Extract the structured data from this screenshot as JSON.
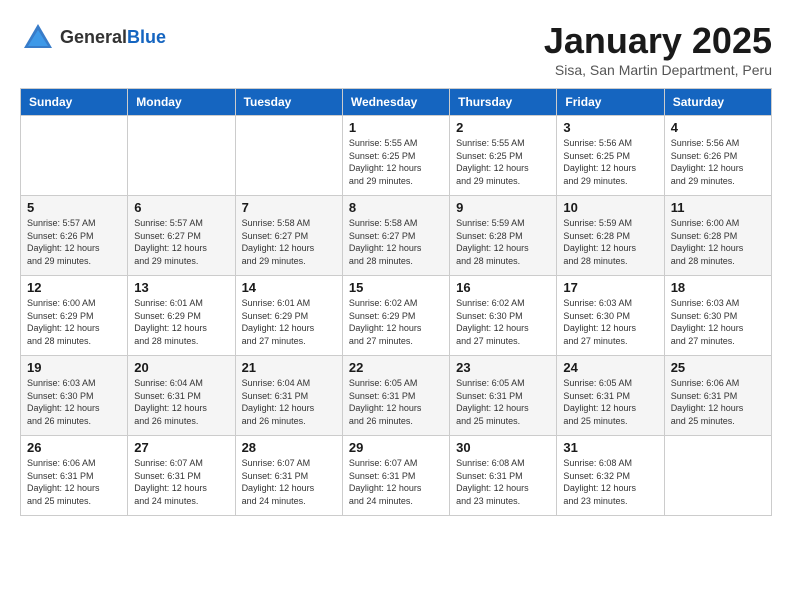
{
  "header": {
    "logo": {
      "general": "General",
      "blue": "Blue"
    },
    "title": "January 2025",
    "subtitle": "Sisa, San Martin Department, Peru"
  },
  "calendar": {
    "days_of_week": [
      "Sunday",
      "Monday",
      "Tuesday",
      "Wednesday",
      "Thursday",
      "Friday",
      "Saturday"
    ],
    "weeks": [
      [
        {
          "day": "",
          "info": ""
        },
        {
          "day": "",
          "info": ""
        },
        {
          "day": "",
          "info": ""
        },
        {
          "day": "1",
          "info": "Sunrise: 5:55 AM\nSunset: 6:25 PM\nDaylight: 12 hours\nand 29 minutes."
        },
        {
          "day": "2",
          "info": "Sunrise: 5:55 AM\nSunset: 6:25 PM\nDaylight: 12 hours\nand 29 minutes."
        },
        {
          "day": "3",
          "info": "Sunrise: 5:56 AM\nSunset: 6:25 PM\nDaylight: 12 hours\nand 29 minutes."
        },
        {
          "day": "4",
          "info": "Sunrise: 5:56 AM\nSunset: 6:26 PM\nDaylight: 12 hours\nand 29 minutes."
        }
      ],
      [
        {
          "day": "5",
          "info": "Sunrise: 5:57 AM\nSunset: 6:26 PM\nDaylight: 12 hours\nand 29 minutes."
        },
        {
          "day": "6",
          "info": "Sunrise: 5:57 AM\nSunset: 6:27 PM\nDaylight: 12 hours\nand 29 minutes."
        },
        {
          "day": "7",
          "info": "Sunrise: 5:58 AM\nSunset: 6:27 PM\nDaylight: 12 hours\nand 29 minutes."
        },
        {
          "day": "8",
          "info": "Sunrise: 5:58 AM\nSunset: 6:27 PM\nDaylight: 12 hours\nand 28 minutes."
        },
        {
          "day": "9",
          "info": "Sunrise: 5:59 AM\nSunset: 6:28 PM\nDaylight: 12 hours\nand 28 minutes."
        },
        {
          "day": "10",
          "info": "Sunrise: 5:59 AM\nSunset: 6:28 PM\nDaylight: 12 hours\nand 28 minutes."
        },
        {
          "day": "11",
          "info": "Sunrise: 6:00 AM\nSunset: 6:28 PM\nDaylight: 12 hours\nand 28 minutes."
        }
      ],
      [
        {
          "day": "12",
          "info": "Sunrise: 6:00 AM\nSunset: 6:29 PM\nDaylight: 12 hours\nand 28 minutes."
        },
        {
          "day": "13",
          "info": "Sunrise: 6:01 AM\nSunset: 6:29 PM\nDaylight: 12 hours\nand 28 minutes."
        },
        {
          "day": "14",
          "info": "Sunrise: 6:01 AM\nSunset: 6:29 PM\nDaylight: 12 hours\nand 27 minutes."
        },
        {
          "day": "15",
          "info": "Sunrise: 6:02 AM\nSunset: 6:29 PM\nDaylight: 12 hours\nand 27 minutes."
        },
        {
          "day": "16",
          "info": "Sunrise: 6:02 AM\nSunset: 6:30 PM\nDaylight: 12 hours\nand 27 minutes."
        },
        {
          "day": "17",
          "info": "Sunrise: 6:03 AM\nSunset: 6:30 PM\nDaylight: 12 hours\nand 27 minutes."
        },
        {
          "day": "18",
          "info": "Sunrise: 6:03 AM\nSunset: 6:30 PM\nDaylight: 12 hours\nand 27 minutes."
        }
      ],
      [
        {
          "day": "19",
          "info": "Sunrise: 6:03 AM\nSunset: 6:30 PM\nDaylight: 12 hours\nand 26 minutes."
        },
        {
          "day": "20",
          "info": "Sunrise: 6:04 AM\nSunset: 6:31 PM\nDaylight: 12 hours\nand 26 minutes."
        },
        {
          "day": "21",
          "info": "Sunrise: 6:04 AM\nSunset: 6:31 PM\nDaylight: 12 hours\nand 26 minutes."
        },
        {
          "day": "22",
          "info": "Sunrise: 6:05 AM\nSunset: 6:31 PM\nDaylight: 12 hours\nand 26 minutes."
        },
        {
          "day": "23",
          "info": "Sunrise: 6:05 AM\nSunset: 6:31 PM\nDaylight: 12 hours\nand 25 minutes."
        },
        {
          "day": "24",
          "info": "Sunrise: 6:05 AM\nSunset: 6:31 PM\nDaylight: 12 hours\nand 25 minutes."
        },
        {
          "day": "25",
          "info": "Sunrise: 6:06 AM\nSunset: 6:31 PM\nDaylight: 12 hours\nand 25 minutes."
        }
      ],
      [
        {
          "day": "26",
          "info": "Sunrise: 6:06 AM\nSunset: 6:31 PM\nDaylight: 12 hours\nand 25 minutes."
        },
        {
          "day": "27",
          "info": "Sunrise: 6:07 AM\nSunset: 6:31 PM\nDaylight: 12 hours\nand 24 minutes."
        },
        {
          "day": "28",
          "info": "Sunrise: 6:07 AM\nSunset: 6:31 PM\nDaylight: 12 hours\nand 24 minutes."
        },
        {
          "day": "29",
          "info": "Sunrise: 6:07 AM\nSunset: 6:31 PM\nDaylight: 12 hours\nand 24 minutes."
        },
        {
          "day": "30",
          "info": "Sunrise: 6:08 AM\nSunset: 6:31 PM\nDaylight: 12 hours\nand 23 minutes."
        },
        {
          "day": "31",
          "info": "Sunrise: 6:08 AM\nSunset: 6:32 PM\nDaylight: 12 hours\nand 23 minutes."
        },
        {
          "day": "",
          "info": ""
        }
      ]
    ]
  }
}
